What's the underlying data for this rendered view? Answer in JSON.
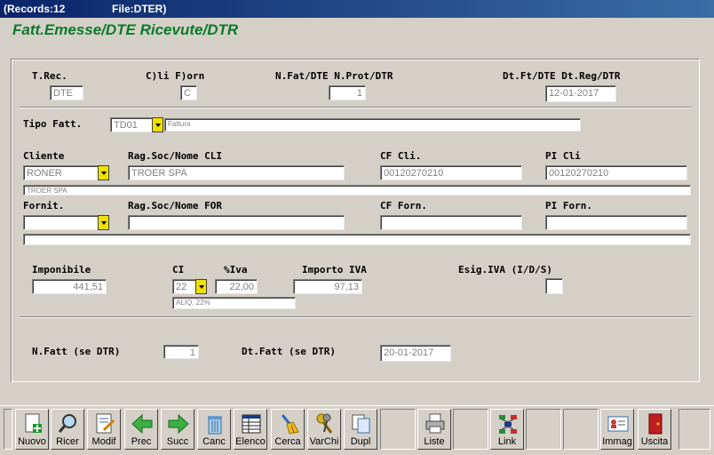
{
  "window": {
    "records_label": "(Records:12",
    "file_label": "File:DTER)"
  },
  "form_title": "Fatt.Emesse/DTE Ricevute/DTR",
  "labels": {
    "t_rec": "T.Rec.",
    "cli_forn": "C)li F)orn",
    "nfat": "N.Fat/DTE N.Prot/DTR",
    "dtft": "Dt.Ft/DTE Dt.Reg/DTR",
    "tipo_fatt": "Tipo Fatt.",
    "cliente": "Cliente",
    "ragsoc_cli": "Rag.Soc/Nome CLI",
    "cf_cli": "CF Cli.",
    "pi_cli": "PI Cli",
    "fornit": "Fornit.",
    "ragsoc_for": "Rag.Soc/Nome FOR",
    "cf_forn": "CF Forn.",
    "pi_forn": "PI Forn.",
    "imponibile": "Imponibile",
    "ci": "CI",
    "piva": "%Iva",
    "importo_iva": "Importo IVA",
    "esig_iva": "Esig.IVA (I/D/S)",
    "nfatt_dtr": "N.Fatt (se DTR)",
    "dtfatt_dtr": "Dt.Fatt (se DTR)"
  },
  "values": {
    "t_rec": "DTE",
    "cli_forn": "C",
    "nfat": "1",
    "dtft": "12-01-2017",
    "tipo_fatt_code": "TD01",
    "tipo_fatt_desc": "Fattura",
    "cliente": "RONER",
    "ragsoc_cli": "TROER SPA",
    "cf_cli": "00120270210",
    "pi_cli": "00120270210",
    "cliente_desc": "TROER SPA",
    "fornit": "",
    "ragsoc_for": "",
    "cf_forn": "",
    "pi_forn": "",
    "fornit_desc": "",
    "imponibile": "441,51",
    "ci": "22",
    "piva": "22,00",
    "importo_iva": "97,13",
    "aliq_desc": "ALIQ. 22%",
    "esig_iva": "",
    "nfatt_dtr": "1",
    "dtfatt_dtr": "20-01-2017"
  },
  "toolbar": [
    {
      "label": "Nuovo",
      "icon": "new-document-icon"
    },
    {
      "label": "Ricer",
      "icon": "magnifier-icon"
    },
    {
      "label": "Modif",
      "icon": "edit-document-icon"
    },
    {
      "label": "Prec",
      "icon": "arrow-left-icon"
    },
    {
      "label": "Succ",
      "icon": "arrow-right-icon"
    },
    {
      "label": "Canc",
      "icon": "trash-icon"
    },
    {
      "label": "Elenco",
      "icon": "list-table-icon"
    },
    {
      "label": "Cerca",
      "icon": "broom-icon"
    },
    {
      "label": "VarChi",
      "icon": "keys-icon"
    },
    {
      "label": "Dupl",
      "icon": "duplicate-icon"
    },
    {
      "label": "Liste",
      "icon": "printer-icon"
    },
    {
      "label": "Link",
      "icon": "network-link-icon"
    },
    {
      "label": "Immag",
      "icon": "id-card-icon"
    },
    {
      "label": "Uscita",
      "icon": "exit-door-icon"
    }
  ]
}
